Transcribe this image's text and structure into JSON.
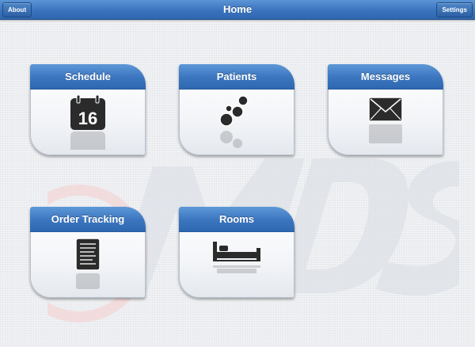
{
  "navbar": {
    "title": "Home",
    "left_button": "About",
    "right_button": "Settings"
  },
  "tiles": [
    {
      "label": "Schedule",
      "icon": "calendar-icon",
      "icon_text": "16"
    },
    {
      "label": "Patients",
      "icon": "patients-bubbles-icon"
    },
    {
      "label": "Messages",
      "icon": "envelope-icon"
    },
    {
      "label": "Order Tracking",
      "icon": "document-icon"
    },
    {
      "label": "Rooms",
      "icon": "bed-icon"
    }
  ],
  "watermark": {
    "text": "MDS"
  },
  "colors": {
    "accent": "#3a73bd",
    "background": "#eceef1",
    "icon": "#2b2b2b"
  }
}
